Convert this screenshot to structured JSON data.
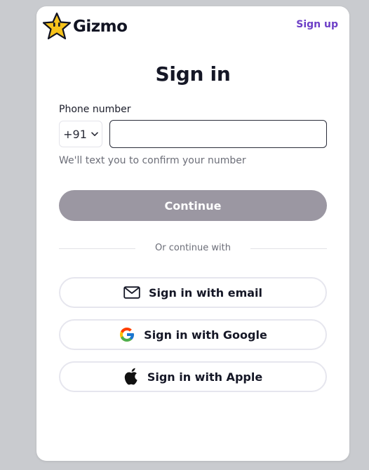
{
  "brand": {
    "name": "Gizmo",
    "logo_icon": "star-mascot-icon",
    "accent_color": "#6d3fc7"
  },
  "header": {
    "signup_label": "Sign up"
  },
  "form": {
    "title": "Sign in",
    "phone_label": "Phone number",
    "country_code": "+91",
    "phone_value": "",
    "helper_text": "We'll text you to confirm your number",
    "continue_label": "Continue",
    "continue_enabled": false
  },
  "divider": {
    "text": "Or continue with"
  },
  "social": [
    {
      "label": "Sign in with email",
      "icon": "envelope-icon"
    },
    {
      "label": "Sign in with Google",
      "icon": "google-icon"
    },
    {
      "label": "Sign in with Apple",
      "icon": "apple-icon"
    }
  ]
}
